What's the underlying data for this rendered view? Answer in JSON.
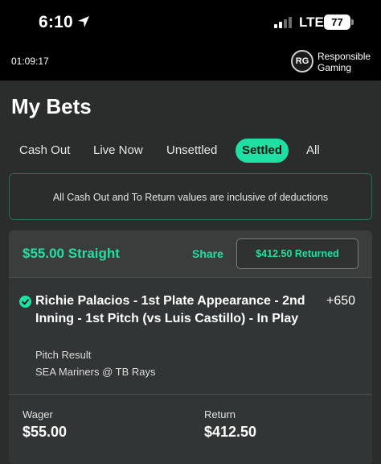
{
  "status_bar": {
    "time": "6:10",
    "network": "LTE",
    "battery": "77"
  },
  "session": {
    "timer": "01:09:17",
    "rg_badge": "RG",
    "rg_line1": "Responsible",
    "rg_line2": "Gaming"
  },
  "page": {
    "title": "My Bets"
  },
  "tabs": [
    {
      "label": "Cash Out",
      "active": false
    },
    {
      "label": "Live Now",
      "active": false
    },
    {
      "label": "Unsettled",
      "active": false
    },
    {
      "label": "Settled",
      "active": true
    },
    {
      "label": "All",
      "active": false
    }
  ],
  "notice": "All Cash Out and To Return values are inclusive of deductions",
  "bet": {
    "title": "$55.00 Straight",
    "share_label": "Share",
    "returned_label": "$412.50  Returned",
    "selection": "Richie Palacios - 1st Plate Appearance - 2nd Inning - 1st Pitch (vs Luis Castillo) - In Play",
    "odds": "+650",
    "market": "Pitch Result",
    "event": "SEA Mariners @ TB Rays",
    "result": "won",
    "wager_label": "Wager",
    "wager_value": "$55.00",
    "return_label": "Return",
    "return_value": "$412.50"
  },
  "colors": {
    "accent": "#1fe0a2",
    "background": "#2a2d2c",
    "card": "#323535",
    "status_bar": "#000000"
  }
}
